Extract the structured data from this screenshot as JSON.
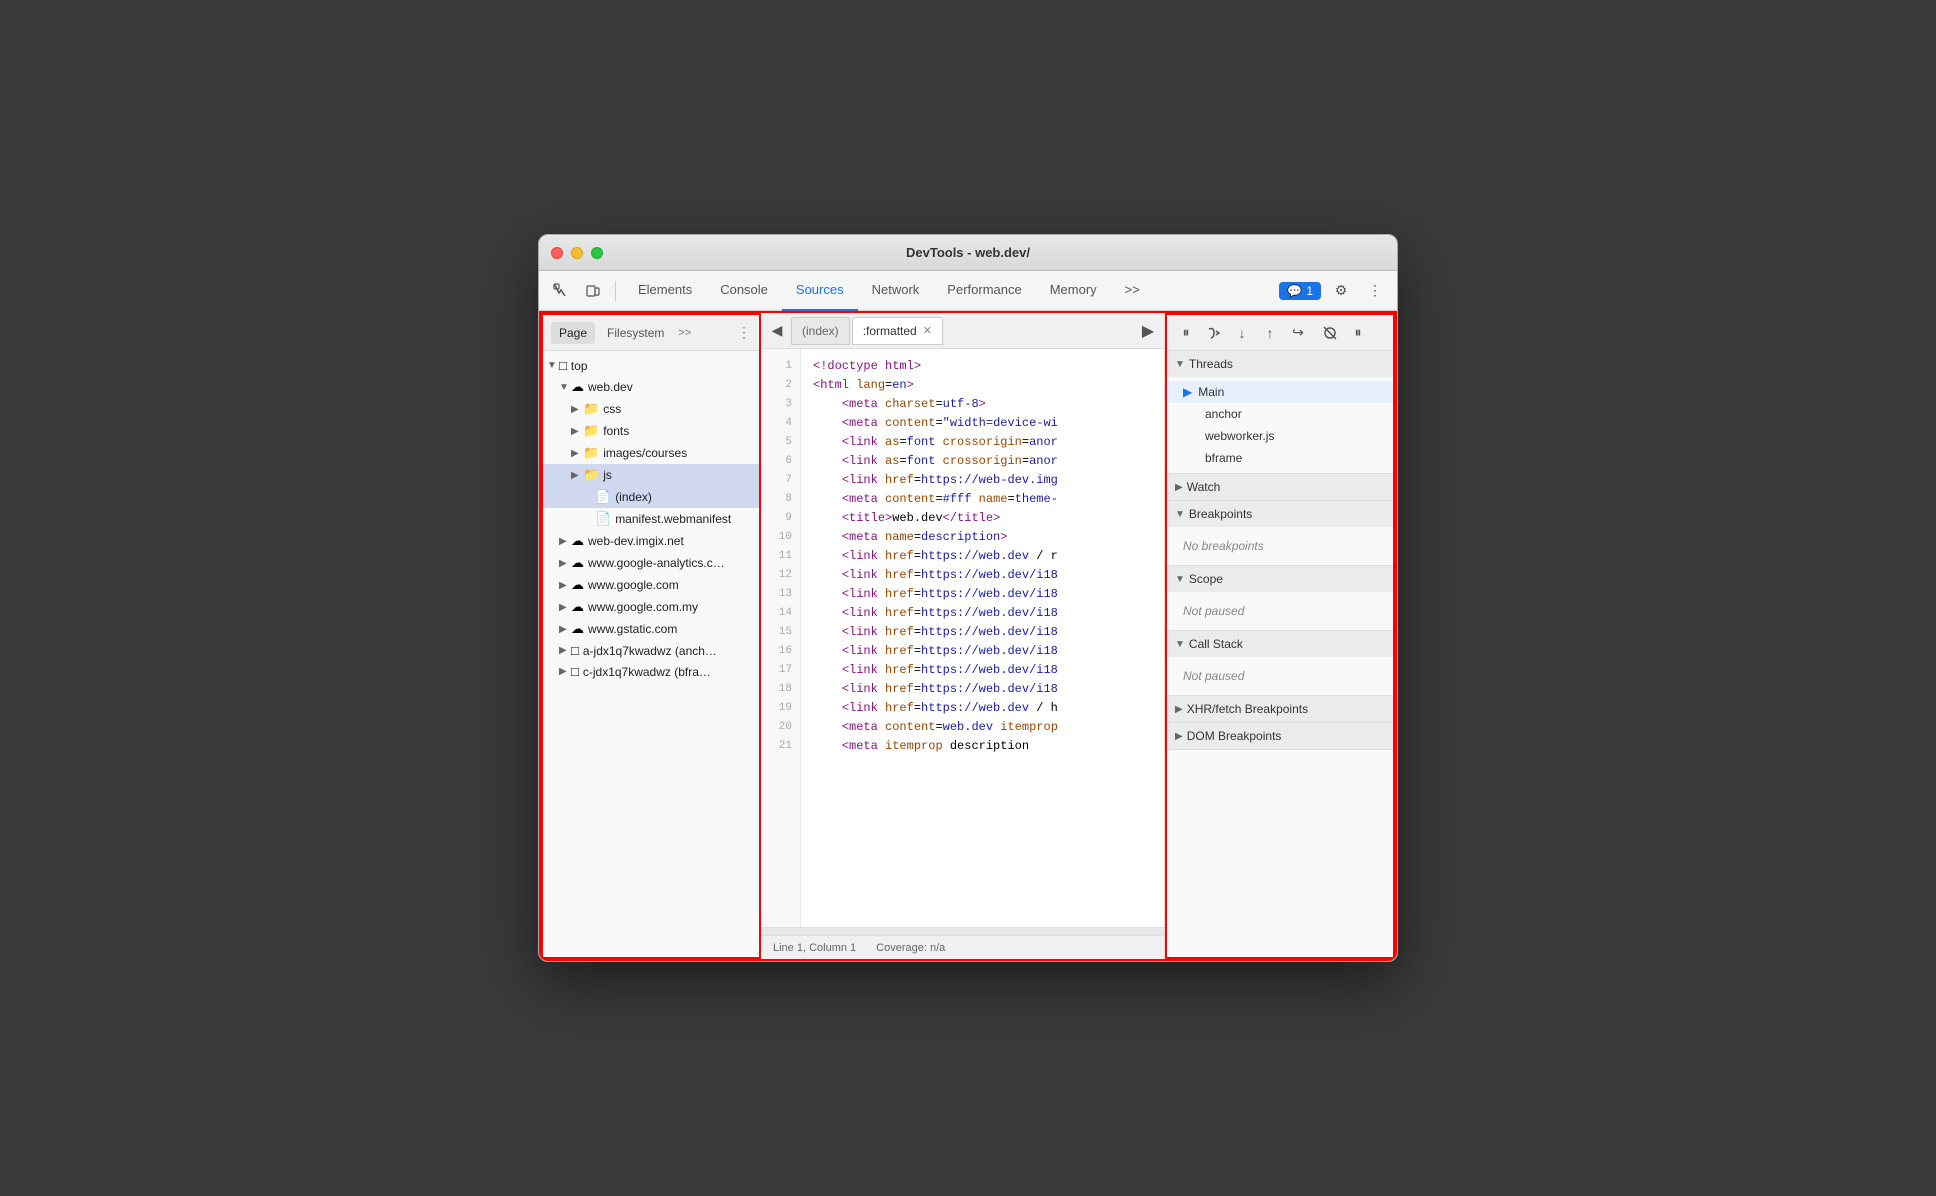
{
  "titlebar": {
    "title": "DevTools - web.dev/"
  },
  "toolbar": {
    "tabs": [
      {
        "id": "elements",
        "label": "Elements",
        "active": false
      },
      {
        "id": "console",
        "label": "Console",
        "active": false
      },
      {
        "id": "sources",
        "label": "Sources",
        "active": true
      },
      {
        "id": "network",
        "label": "Network",
        "active": false
      },
      {
        "id": "performance",
        "label": "Performance",
        "active": false
      },
      {
        "id": "memory",
        "label": "Memory",
        "active": false
      }
    ],
    "more_tabs": ">>",
    "comment_count": "1",
    "settings_label": "⚙",
    "more_label": "⋮"
  },
  "left_panel": {
    "tabs": [
      {
        "id": "page",
        "label": "Page",
        "active": true
      },
      {
        "id": "filesystem",
        "label": "Filesystem",
        "active": false
      }
    ],
    "more": ">>",
    "menu": "⋮",
    "tree": [
      {
        "level": 0,
        "arrow": "▼",
        "icon": "📄",
        "label": "top",
        "type": "root"
      },
      {
        "level": 1,
        "arrow": "▼",
        "icon": "☁",
        "label": "web.dev",
        "type": "domain"
      },
      {
        "level": 2,
        "arrow": "▶",
        "icon": "📁",
        "label": "css",
        "type": "folder"
      },
      {
        "level": 2,
        "arrow": "▶",
        "icon": "📁",
        "label": "fonts",
        "type": "folder"
      },
      {
        "level": 2,
        "arrow": "▶",
        "icon": "📁",
        "label": "images/courses",
        "type": "folder"
      },
      {
        "level": 2,
        "arrow": "▶",
        "icon": "📁",
        "label": "js",
        "type": "folder",
        "selected": true
      },
      {
        "level": 2,
        "arrow": " ",
        "icon": "📄",
        "label": "(index)",
        "type": "file",
        "selected": true
      },
      {
        "level": 2,
        "arrow": " ",
        "icon": "📄",
        "label": "manifest.webmanifest",
        "type": "file"
      },
      {
        "level": 1,
        "arrow": "▶",
        "icon": "☁",
        "label": "web-dev.imgix.net",
        "type": "domain"
      },
      {
        "level": 1,
        "arrow": "▶",
        "icon": "☁",
        "label": "www.google-analytics.c…",
        "type": "domain"
      },
      {
        "level": 1,
        "arrow": "▶",
        "icon": "☁",
        "label": "www.google.com",
        "type": "domain"
      },
      {
        "level": 1,
        "arrow": "▶",
        "icon": "☁",
        "label": "www.google.com.my",
        "type": "domain"
      },
      {
        "level": 1,
        "arrow": "▶",
        "icon": "☁",
        "label": "www.gstatic.com",
        "type": "domain"
      },
      {
        "level": 1,
        "arrow": "▶",
        "icon": "□",
        "label": "a-jdx1q7kwadwz (anch…",
        "type": "frame"
      },
      {
        "level": 1,
        "arrow": "▶",
        "icon": "□",
        "label": "c-jdx1q7kwadwz (bfra…",
        "type": "frame"
      }
    ]
  },
  "editor": {
    "tabs": [
      {
        "id": "index",
        "label": "(index)",
        "active": false
      },
      {
        "id": "formatted",
        "label": ":formatted",
        "active": true
      }
    ],
    "lines": [
      {
        "num": 1,
        "content": "<!doctype html>"
      },
      {
        "num": 2,
        "content": "<html lang=en>"
      },
      {
        "num": 3,
        "content": "    <meta charset=utf-8>"
      },
      {
        "num": 4,
        "content": "    <meta content=\"width=device-wi"
      },
      {
        "num": 5,
        "content": "    <link as=font crossorigin=anor"
      },
      {
        "num": 6,
        "content": "    <link as=font crossorigin=anor"
      },
      {
        "num": 7,
        "content": "    <link href=https://web-dev.img"
      },
      {
        "num": 8,
        "content": "    <meta content=#fff name=theme-"
      },
      {
        "num": 9,
        "content": "    <title>web.dev</title>"
      },
      {
        "num": 10,
        "content": "    <meta name=description>"
      },
      {
        "num": 11,
        "content": "    <link href=https://web.dev / r"
      },
      {
        "num": 12,
        "content": "    <link href=https://web.dev/i18"
      },
      {
        "num": 13,
        "content": "    <link href=https://web.dev/i18"
      },
      {
        "num": 14,
        "content": "    <link href=https://web.dev/i18"
      },
      {
        "num": 15,
        "content": "    <link href=https://web.dev/i18"
      },
      {
        "num": 16,
        "content": "    <link href=https://web.dev/i18"
      },
      {
        "num": 17,
        "content": "    <link href=https://web.dev/i18"
      },
      {
        "num": 18,
        "content": "    <link href=https://web.dev/i18"
      },
      {
        "num": 19,
        "content": "    <link href=https://web.dev / h"
      },
      {
        "num": 20,
        "content": "    <meta content=web.dev itemprop"
      },
      {
        "num": 21,
        "content": "    <meta itemprop description"
      }
    ],
    "statusbar": {
      "position": "Line 1, Column 1",
      "coverage": "Coverage: n/a"
    }
  },
  "right_panel": {
    "sections": {
      "threads": {
        "label": "Threads",
        "items": [
          {
            "label": "Main",
            "active": true
          },
          {
            "label": "anchor"
          },
          {
            "label": "webworker.js"
          },
          {
            "label": "bframe"
          }
        ]
      },
      "watch": {
        "label": "Watch"
      },
      "breakpoints": {
        "label": "Breakpoints",
        "empty": "No breakpoints"
      },
      "scope": {
        "label": "Scope",
        "empty": "Not paused"
      },
      "call_stack": {
        "label": "Call Stack",
        "empty": "Not paused"
      },
      "xhr_breakpoints": {
        "label": "XHR/fetch Breakpoints"
      },
      "dom_breakpoints": {
        "label": "DOM Breakpoints"
      }
    }
  }
}
